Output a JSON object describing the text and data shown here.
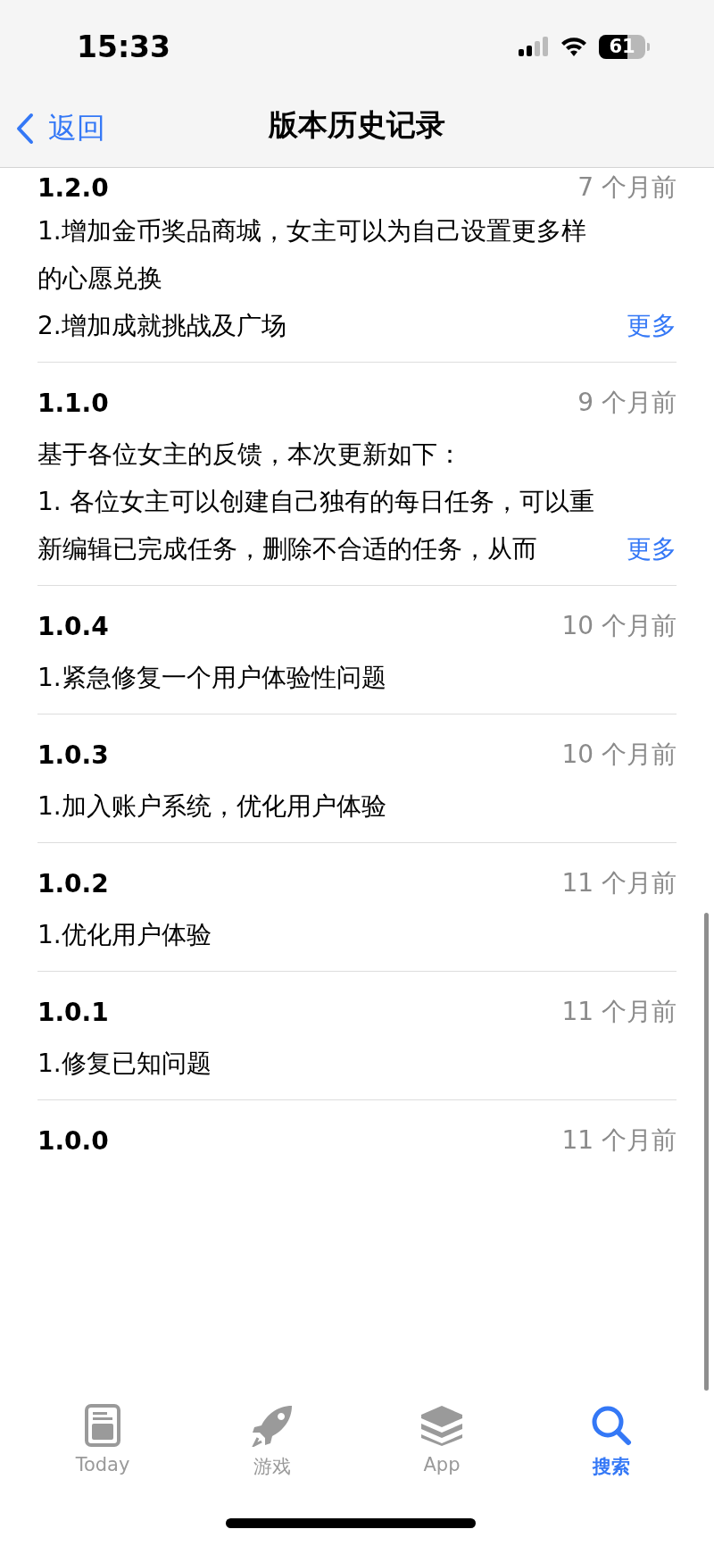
{
  "status_bar": {
    "time": "15:33",
    "battery": "61"
  },
  "nav": {
    "back": "返回",
    "title": "版本历史记录"
  },
  "versions": [
    {
      "version": "1.2.0",
      "date": "7 个月前",
      "lines": [
        "1.增加金币奖品商城，女主可以为自己设置更多样",
        "的心愿兑换",
        "2.增加成就挑战及广场"
      ],
      "more": "更多"
    },
    {
      "version": "1.1.0",
      "date": "9 个月前",
      "lines": [
        "基于各位女主的反馈，本次更新如下：",
        "1. 各位女主可以创建自己独有的每日任务，可以重",
        "新编辑已完成任务，删除不合适的任务，从而"
      ],
      "more": "更多"
    },
    {
      "version": "1.0.4",
      "date": "10 个月前",
      "lines": [
        "1.紧急修复一个用户体验性问题"
      ]
    },
    {
      "version": "1.0.3",
      "date": "10 个月前",
      "lines": [
        "1.加入账户系统，优化用户体验"
      ]
    },
    {
      "version": "1.0.2",
      "date": "11 个月前",
      "lines": [
        "1.优化用户体验"
      ]
    },
    {
      "version": "1.0.1",
      "date": "11 个月前",
      "lines": [
        "1.修复已知问题"
      ]
    },
    {
      "version": "1.0.0",
      "date": "11 个月前"
    }
  ],
  "tabs": [
    {
      "kind": "today",
      "label": "Today",
      "selected": false
    },
    {
      "kind": "games",
      "label": "游戏",
      "selected": false
    },
    {
      "kind": "apps",
      "label": "App",
      "selected": false
    },
    {
      "kind": "search",
      "label": "搜索",
      "selected": true
    }
  ]
}
